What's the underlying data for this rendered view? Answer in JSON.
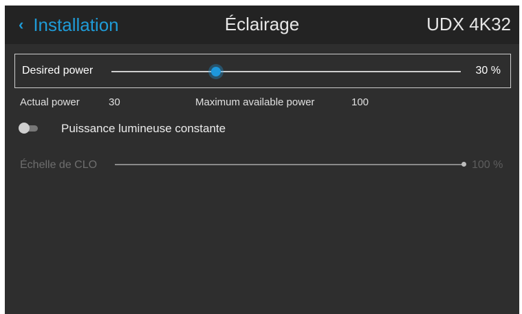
{
  "header": {
    "back_label": "Installation",
    "title": "Éclairage",
    "model": "UDX 4K32"
  },
  "desired_power": {
    "label": "Desired power",
    "value_text": "30 %",
    "value_fraction": 0.3
  },
  "info": {
    "actual_power_label": "Actual power",
    "actual_power_value": "30",
    "max_power_label": "Maximum available power",
    "max_power_value": "100"
  },
  "constant_light": {
    "label": "Puissance lumineuse constante",
    "enabled": false
  },
  "clo_scale": {
    "label": "Échelle de CLO",
    "value_text": "100 %",
    "value_fraction": 1.0,
    "disabled": true
  },
  "colors": {
    "accent": "#1f9bd7",
    "background": "#2e2e2e",
    "header": "#232323"
  }
}
